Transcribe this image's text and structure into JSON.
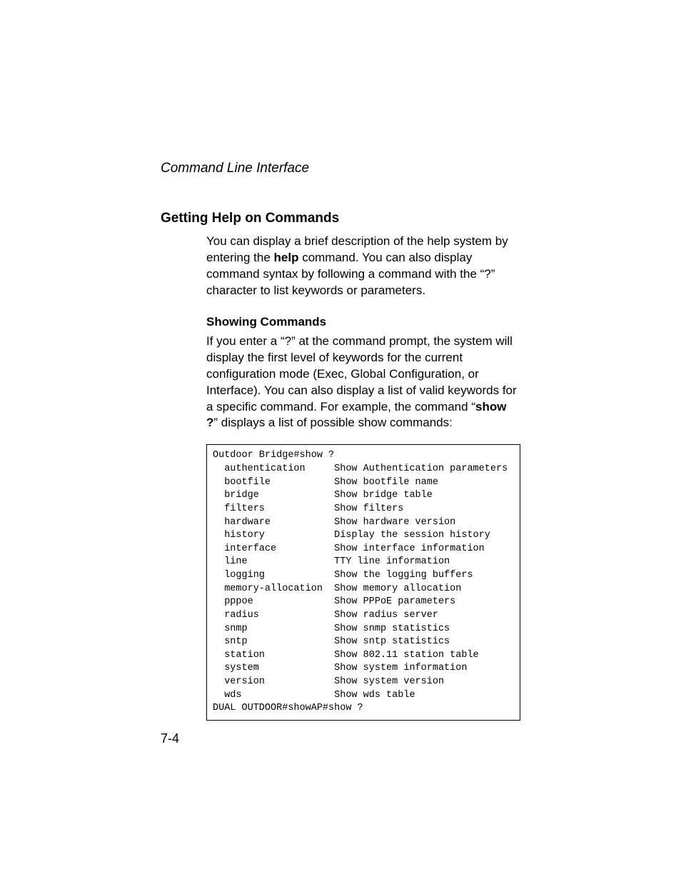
{
  "header": {
    "running": "Command Line Interface"
  },
  "section": {
    "title": "Getting Help on Commands",
    "para1_a": "You can display a brief description of the help system by entering the ",
    "para1_bold": "help",
    "para1_b": " command. You can also display command syntax by following a command with the “?” character to list keywords or parameters.",
    "sub_heading": "Showing Commands",
    "para2_a": "If you enter a “?” at the command prompt, the system will display the first level of keywords for the current configuration mode (Exec, Global Configuration, or Interface). You can also display a list of valid keywords for a specific command. For example, the command “",
    "para2_bold": "show ?",
    "para2_b": "” displays a list of possible show commands:"
  },
  "code": {
    "prompt_top": "Outdoor Bridge#show ?",
    "rows": [
      {
        "kw": "authentication",
        "desc": "Show Authentication parameters"
      },
      {
        "kw": "bootfile",
        "desc": "Show bootfile name"
      },
      {
        "kw": "bridge",
        "desc": "Show bridge table"
      },
      {
        "kw": "filters",
        "desc": "Show filters"
      },
      {
        "kw": "hardware",
        "desc": "Show hardware version"
      },
      {
        "kw": "history",
        "desc": "Display the session history"
      },
      {
        "kw": "interface",
        "desc": "Show interface information"
      },
      {
        "kw": "line",
        "desc": "TTY line information"
      },
      {
        "kw": "logging",
        "desc": "Show the logging buffers"
      },
      {
        "kw": "memory-allocation",
        "desc": "Show memory allocation"
      },
      {
        "kw": "pppoe",
        "desc": "Show PPPoE parameters"
      },
      {
        "kw": "radius",
        "desc": "Show radius server"
      },
      {
        "kw": "snmp",
        "desc": "Show snmp statistics"
      },
      {
        "kw": "sntp",
        "desc": "Show sntp statistics"
      },
      {
        "kw": "station",
        "desc": "Show 802.11 station table"
      },
      {
        "kw": "system",
        "desc": "Show system information"
      },
      {
        "kw": "version",
        "desc": "Show system version"
      },
      {
        "kw": "wds",
        "desc": "Show wds table"
      }
    ],
    "prompt_bottom": "DUAL OUTDOOR#showAP#show ?"
  },
  "footer": {
    "page": "7-4"
  }
}
